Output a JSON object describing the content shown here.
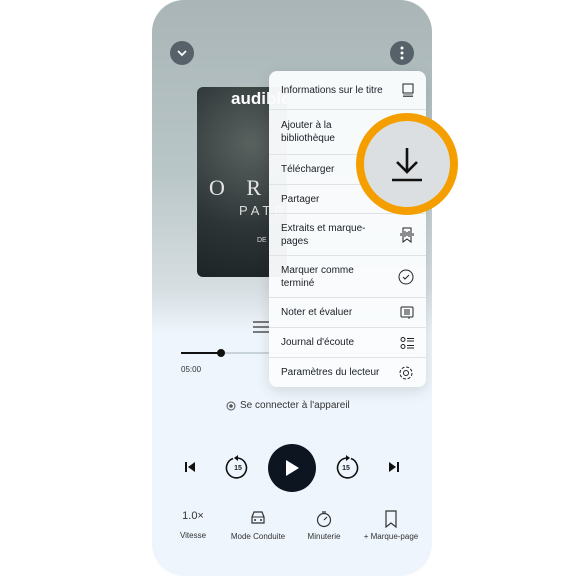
{
  "cover": {
    "brand": "audible",
    "title": "O R",
    "subtitle": "PATR",
    "footer": "DE"
  },
  "menu": {
    "items": [
      {
        "label": "Informations sur le titre",
        "icon": "book-icon"
      },
      {
        "label": "Ajouter à la bibliothèque",
        "icon": "add-library-icon"
      },
      {
        "label": "Télécharger",
        "icon": "download-icon"
      },
      {
        "label": "Partager",
        "icon": "share-icon"
      },
      {
        "label": "Extraits et marque-pages",
        "icon": "clips-bookmark-icon"
      },
      {
        "label": "Marquer comme terminé",
        "icon": "check-circle-icon"
      },
      {
        "label": "Noter et évaluer",
        "icon": "review-icon"
      },
      {
        "label": "Journal d'écoute",
        "icon": "list-icon"
      },
      {
        "label": "Paramètres du lecteur",
        "icon": "gear-icon"
      }
    ]
  },
  "highlight_color": "#f59e00",
  "player": {
    "elapsed": "05:00",
    "progress_percent": 17,
    "connect_label": "Se connecter à l'appareil",
    "skip_seconds": "15"
  },
  "bottom": {
    "speed_value": "1.0×",
    "speed_label": "Vitesse",
    "drive_label": "Mode Conduite",
    "timer_label": "Minuterie",
    "bookmark_label": "+ Marque-page"
  }
}
